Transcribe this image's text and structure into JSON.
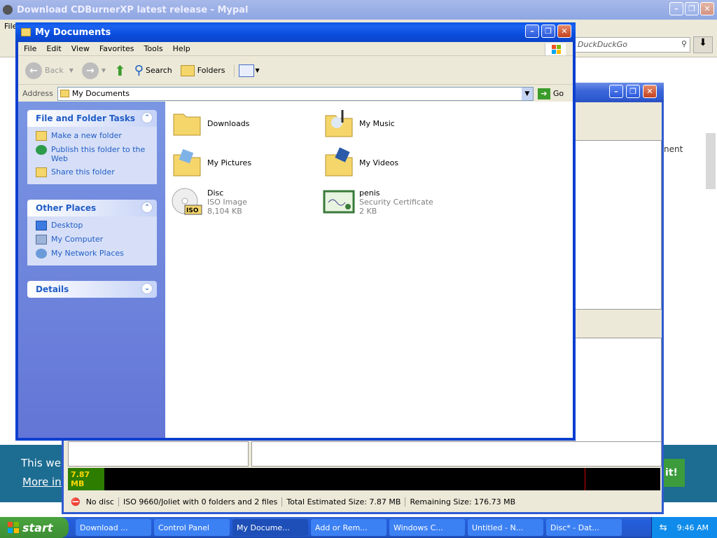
{
  "browser": {
    "title": "Download CDBurnerXP latest release - Mypal",
    "menu_file": "File",
    "search_placeholder": "DuckDuckGo",
    "side_text": "nent",
    "banner_text1": "This web",
    "banner_text2": "More inf",
    "banner_button": "it!"
  },
  "cdburner": {
    "size_label": "7.87 MB",
    "status": {
      "disc": "No disc",
      "format": "ISO 9660/Joliet with 0 folders and 2 files",
      "total": "Total Estimated Size: 7.87 MB",
      "remaining": "Remaining Size: 176.73 MB"
    },
    "fill_fraction": 0.045
  },
  "explorer": {
    "title": "My Documents",
    "menu": [
      "File",
      "Edit",
      "View",
      "Favorites",
      "Tools",
      "Help"
    ],
    "toolbar": {
      "back": "Back",
      "search": "Search",
      "folders": "Folders"
    },
    "address_label": "Address",
    "address_value": "My Documents",
    "go": "Go",
    "tasks_header": "File and Folder Tasks",
    "tasks": [
      "Make a new folder",
      "Publish this folder to the Web",
      "Share this folder"
    ],
    "places_header": "Other Places",
    "places": [
      "Desktop",
      "My Computer",
      "My Network Places"
    ],
    "details_header": "Details",
    "items": [
      {
        "name": "Downloads"
      },
      {
        "name": "My Music"
      },
      {
        "name": "My Pictures"
      },
      {
        "name": "My Videos"
      },
      {
        "name": "Disc",
        "type": "ISO Image",
        "size": "8,104 KB"
      },
      {
        "name": "penis",
        "type": "Security Certificate",
        "size": "2 KB"
      }
    ]
  },
  "taskbar": {
    "start": "start",
    "buttons": [
      "Download ...",
      "Control Panel",
      "My Docume...",
      "Add or Rem...",
      "Windows C...",
      "Untitled - N...",
      "Disc* - Dat..."
    ],
    "clock": "9:46 AM"
  }
}
